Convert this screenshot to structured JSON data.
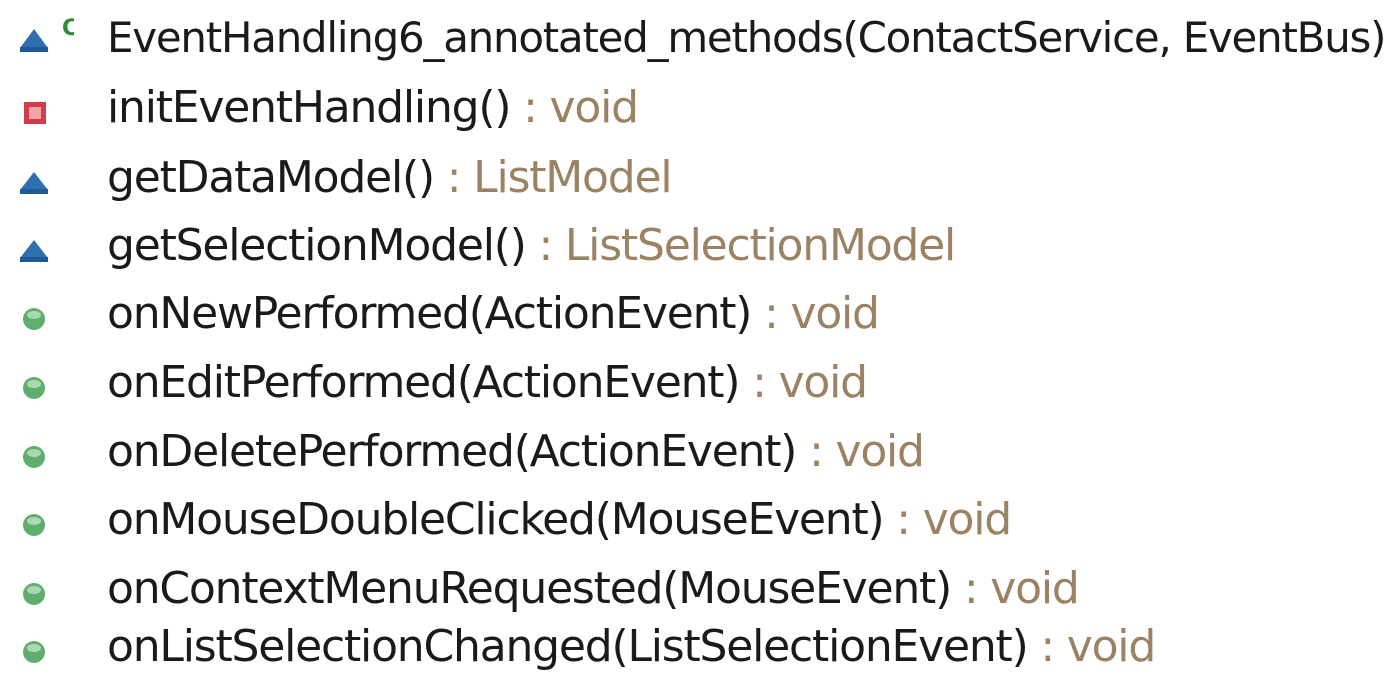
{
  "outline": {
    "members": [
      {
        "icon": "constructor-package-triangle-icon",
        "overlay": "C",
        "signature": "EventHandling6_annotated_methods(ContactService, EventBus)",
        "return_type": ""
      },
      {
        "icon": "private-method-square-icon",
        "signature": "initEventHandling()",
        "return_type": " : void"
      },
      {
        "icon": "package-method-triangle-icon",
        "signature": "getDataModel()",
        "return_type": " : ListModel"
      },
      {
        "icon": "package-method-triangle-icon",
        "signature": "getSelectionModel()",
        "return_type": " : ListSelectionModel"
      },
      {
        "icon": "public-method-circle-icon",
        "signature": "onNewPerformed(ActionEvent)",
        "return_type": " : void"
      },
      {
        "icon": "public-method-circle-icon",
        "signature": "onEditPerformed(ActionEvent)",
        "return_type": " : void"
      },
      {
        "icon": "public-method-circle-icon",
        "signature": "onDeletePerformed(ActionEvent)",
        "return_type": " : void"
      },
      {
        "icon": "public-method-circle-icon",
        "signature": "onMouseDoubleClicked(MouseEvent)",
        "return_type": " : void"
      },
      {
        "icon": "public-method-circle-icon",
        "signature": "onContextMenuRequested(MouseEvent)",
        "return_type": " : void"
      },
      {
        "icon": "public-method-circle-icon",
        "signature": "onListSelectionChanged(ListSelectionEvent)",
        "return_type": " : void"
      }
    ]
  },
  "colors": {
    "signature_text": "#1a1a1a",
    "return_type_text": "#9a8262",
    "package_triangle": "#2f6fb0",
    "private_square": "#d23b4a",
    "public_circle": "#5fae6e",
    "constructor_overlay": "#2e8b3a"
  }
}
